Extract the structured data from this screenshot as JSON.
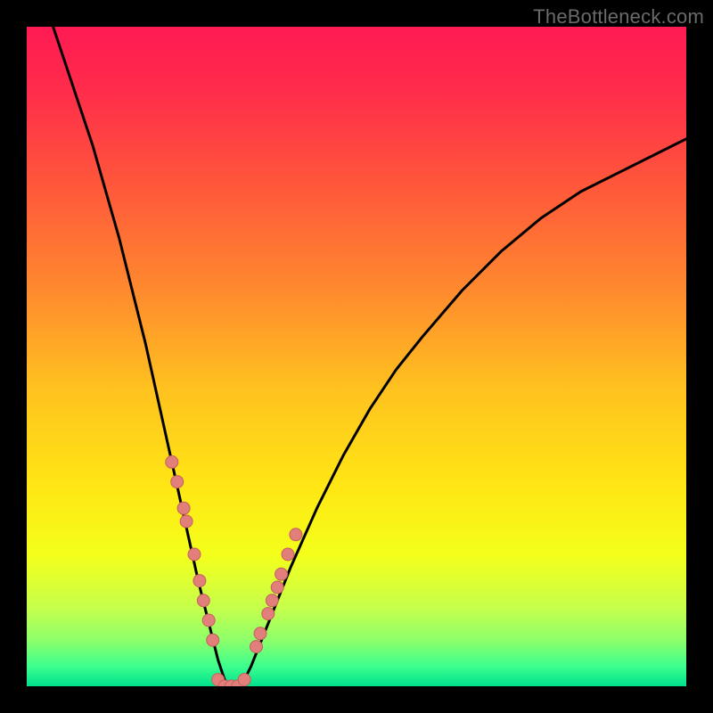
{
  "watermark": "TheBottleneck.com",
  "colors": {
    "frame": "#000000",
    "gradient_stops": [
      {
        "offset": 0.0,
        "color": "#ff1a53"
      },
      {
        "offset": 0.1,
        "color": "#ff2d4a"
      },
      {
        "offset": 0.25,
        "color": "#ff5a3a"
      },
      {
        "offset": 0.4,
        "color": "#ff8a2e"
      },
      {
        "offset": 0.55,
        "color": "#ffc21f"
      },
      {
        "offset": 0.7,
        "color": "#ffe714"
      },
      {
        "offset": 0.8,
        "color": "#f4ff1a"
      },
      {
        "offset": 0.88,
        "color": "#c7ff4a"
      },
      {
        "offset": 0.93,
        "color": "#8dff6a"
      },
      {
        "offset": 0.97,
        "color": "#3cff8e"
      },
      {
        "offset": 1.0,
        "color": "#00e08c"
      }
    ],
    "curve": "#000000",
    "marker_fill": "#e27f7a",
    "marker_stroke": "#c3615d"
  },
  "chart_data": {
    "type": "line",
    "title": "",
    "xlabel": "",
    "ylabel": "",
    "xlim": [
      0,
      100
    ],
    "ylim": [
      0,
      100
    ],
    "note": "Axes are implied (no ticks drawn). x ~ hardware balance parameter, y ~ bottleneck percentage. Curve reaches 0 near x≈31 and rises asymmetrically on both sides. Values are read from pixel positions; y precision ≈ ±3.",
    "series": [
      {
        "name": "bottleneck-curve",
        "x": [
          4,
          6,
          8,
          10,
          12,
          14,
          16,
          18,
          20,
          22,
          24,
          26,
          28,
          29,
          30,
          31,
          32,
          33,
          34,
          36,
          38,
          40,
          44,
          48,
          52,
          56,
          60,
          66,
          72,
          78,
          84,
          90,
          96,
          100
        ],
        "y": [
          100,
          94,
          88,
          82,
          75,
          68,
          60,
          52,
          43,
          34,
          25,
          16,
          8,
          4,
          1,
          0,
          0,
          1,
          3,
          8,
          13,
          18,
          27,
          35,
          42,
          48,
          53,
          60,
          66,
          71,
          75,
          78,
          81,
          83
        ]
      },
      {
        "name": "left-arm-markers",
        "x": [
          22.0,
          22.8,
          23.8,
          24.2,
          25.4,
          26.2,
          26.8,
          27.6,
          28.2
        ],
        "y": [
          34,
          31,
          27,
          25,
          20,
          16,
          13,
          10,
          7
        ]
      },
      {
        "name": "right-arm-markers",
        "x": [
          34.8,
          35.4,
          36.6,
          37.2,
          38.0,
          38.6,
          39.6,
          40.8
        ],
        "y": [
          6,
          8,
          11,
          13,
          15,
          17,
          20,
          23
        ]
      },
      {
        "name": "bottom-markers",
        "x": [
          29.0,
          30.0,
          31.0,
          32.0,
          33.0
        ],
        "y": [
          1,
          0,
          0,
          0,
          1
        ]
      }
    ]
  }
}
